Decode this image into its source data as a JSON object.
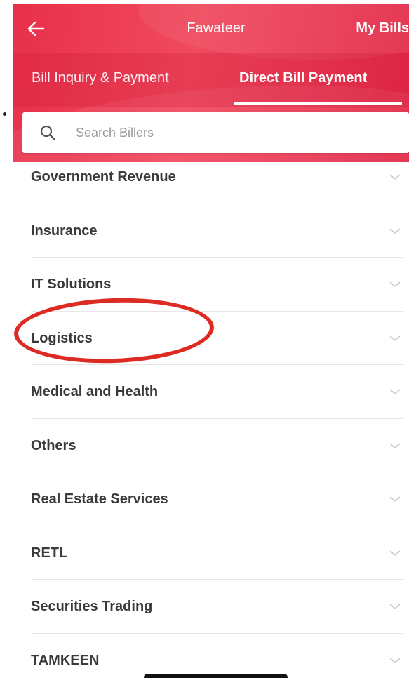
{
  "header": {
    "title": "Fawateer",
    "right_action": "My Bills",
    "back_icon": "arrow-left-icon",
    "accent_color": "#e8304a"
  },
  "tabs": [
    {
      "label": "Bill Inquiry & Payment",
      "active": false
    },
    {
      "label": "Direct Bill Payment",
      "active": true
    }
  ],
  "search": {
    "placeholder": "Search Billers",
    "value": "",
    "icon": "search-icon"
  },
  "categories": [
    {
      "label": "Government Revenue",
      "icon": "chevron-down-icon"
    },
    {
      "label": "Insurance",
      "icon": "chevron-down-icon"
    },
    {
      "label": "IT Solutions",
      "icon": "chevron-down-icon"
    },
    {
      "label": "Logistics",
      "icon": "chevron-down-icon",
      "highlighted": true
    },
    {
      "label": "Medical and Health",
      "icon": "chevron-down-icon"
    },
    {
      "label": "Others",
      "icon": "chevron-down-icon"
    },
    {
      "label": "Real Estate Services",
      "icon": "chevron-down-icon"
    },
    {
      "label": "RETL",
      "icon": "chevron-down-icon"
    },
    {
      "label": "Securities Trading",
      "icon": "chevron-down-icon"
    },
    {
      "label": "TAMKEEN",
      "icon": "chevron-down-icon"
    }
  ],
  "annotation": {
    "circle_color": "#dd2a22",
    "target": "Logistics"
  }
}
